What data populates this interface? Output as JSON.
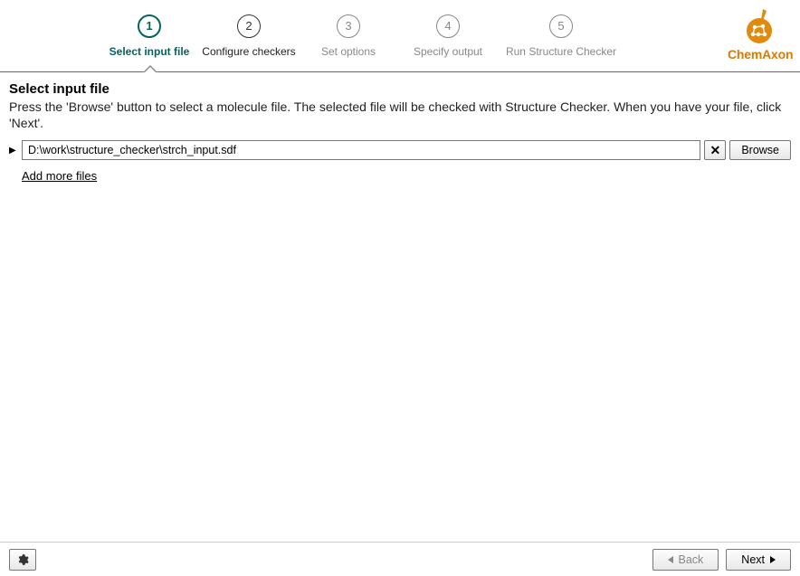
{
  "brand": "ChemAxon",
  "steps": [
    {
      "num": "1",
      "label": "Select input file",
      "state": "active"
    },
    {
      "num": "2",
      "label": "Configure checkers",
      "state": "enabled"
    },
    {
      "num": "3",
      "label": "Set options",
      "state": "disabled"
    },
    {
      "num": "4",
      "label": "Specify output",
      "state": "disabled"
    },
    {
      "num": "5",
      "label": "Run Structure Checker",
      "state": "disabled"
    }
  ],
  "page": {
    "title": "Select input file",
    "instructions": "Press the 'Browse' button to select a molecule file. The selected file will be checked with Structure Checker. When you have your file, click 'Next'."
  },
  "file": {
    "path": "D:\\work\\structure_checker\\strch_input.sdf",
    "clear_glyph": "✕",
    "browse_label": "Browse"
  },
  "add_more_label": "Add more files",
  "footer": {
    "back_label": "Back",
    "next_label": "Next"
  },
  "settings_icon": "gear"
}
